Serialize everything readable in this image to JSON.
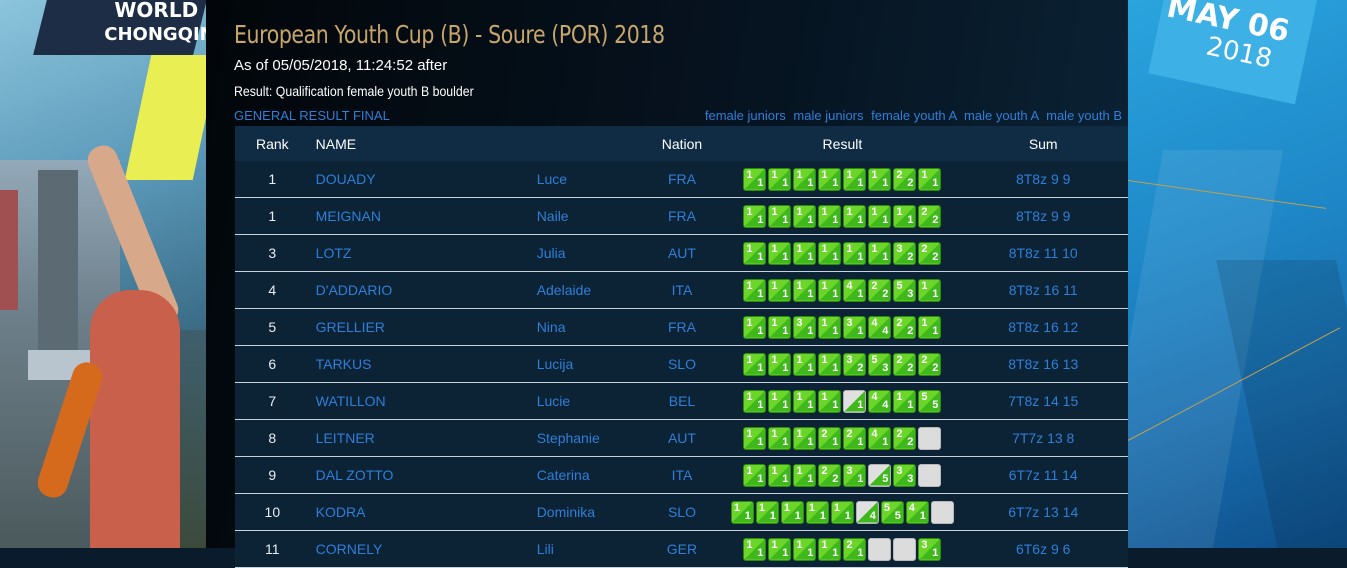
{
  "event_title": "European Youth Cup (B) - Soure (POR) 2018",
  "as_of": "As of 05/05/2018, 11:24:52 after",
  "result_label": "Result: Qualification female youth B boulder",
  "general_link": "GENERAL RESULT FINAL",
  "category_links": [
    "female juniors",
    "male juniors",
    "female youth A",
    "male youth A",
    "male youth B"
  ],
  "banner_left": {
    "line1": "WORLD",
    "line2": "CHONGQIN"
  },
  "banner_right": {
    "date": "MAY 06",
    "year": "2018"
  },
  "colors": {
    "link": "#2f7fd8",
    "title": "#c8a56a",
    "top_box": "#3fb81b",
    "empty_box": "#dcdcdc"
  },
  "table": {
    "headers": {
      "rank": "Rank",
      "name": "NAME",
      "nation": "Nation",
      "result": "Result",
      "sum": "Sum"
    },
    "rows": [
      {
        "rank": "1",
        "last": "DOUADY",
        "first": "Luce",
        "nation": "FRA",
        "sum": "8T8z  9   9",
        "boulders": [
          [
            "1",
            "1"
          ],
          [
            "1",
            "1"
          ],
          [
            "1",
            "1"
          ],
          [
            "1",
            "1"
          ],
          [
            "1",
            "1"
          ],
          [
            "1",
            "1"
          ],
          [
            "2",
            "2"
          ],
          [
            "1",
            "1"
          ]
        ]
      },
      {
        "rank": "1",
        "last": "MEIGNAN",
        "first": "Naile",
        "nation": "FRA",
        "sum": "8T8z  9   9",
        "boulders": [
          [
            "1",
            "1"
          ],
          [
            "1",
            "1"
          ],
          [
            "1",
            "1"
          ],
          [
            "1",
            "1"
          ],
          [
            "1",
            "1"
          ],
          [
            "1",
            "1"
          ],
          [
            "1",
            "1"
          ],
          [
            "2",
            "2"
          ]
        ]
      },
      {
        "rank": "3",
        "last": "LOTZ",
        "first": "Julia",
        "nation": "AUT",
        "sum": "8T8z  11 10",
        "boulders": [
          [
            "1",
            "1"
          ],
          [
            "1",
            "1"
          ],
          [
            "1",
            "1"
          ],
          [
            "1",
            "1"
          ],
          [
            "1",
            "1"
          ],
          [
            "1",
            "1"
          ],
          [
            "3",
            "2"
          ],
          [
            "2",
            "2"
          ]
        ]
      },
      {
        "rank": "4",
        "last": "D'ADDARIO",
        "first": "Adelaide",
        "nation": "ITA",
        "sum": "8T8z  16 11",
        "boulders": [
          [
            "1",
            "1"
          ],
          [
            "1",
            "1"
          ],
          [
            "1",
            "1"
          ],
          [
            "1",
            "1"
          ],
          [
            "4",
            "1"
          ],
          [
            "2",
            "2"
          ],
          [
            "5",
            "3"
          ],
          [
            "1",
            "1"
          ]
        ]
      },
      {
        "rank": "5",
        "last": "GRELLIER",
        "first": "Nina",
        "nation": "FRA",
        "sum": "8T8z  16 12",
        "boulders": [
          [
            "1",
            "1"
          ],
          [
            "1",
            "1"
          ],
          [
            "3",
            "1"
          ],
          [
            "1",
            "1"
          ],
          [
            "3",
            "1"
          ],
          [
            "4",
            "4"
          ],
          [
            "2",
            "2"
          ],
          [
            "1",
            "1"
          ]
        ]
      },
      {
        "rank": "6",
        "last": "TARKUS",
        "first": "Lucija",
        "nation": "SLO",
        "sum": "8T8z  16 13",
        "boulders": [
          [
            "1",
            "1"
          ],
          [
            "1",
            "1"
          ],
          [
            "1",
            "1"
          ],
          [
            "1",
            "1"
          ],
          [
            "3",
            "2"
          ],
          [
            "5",
            "3"
          ],
          [
            "2",
            "2"
          ],
          [
            "2",
            "2"
          ]
        ]
      },
      {
        "rank": "7",
        "last": "WATILLON",
        "first": "Lucie",
        "nation": "BEL",
        "sum": "7T8z  14 15",
        "boulders": [
          [
            "1",
            "1"
          ],
          [
            "1",
            "1"
          ],
          [
            "1",
            "1"
          ],
          [
            "1",
            "1"
          ],
          [
            "",
            "1"
          ],
          [
            "4",
            "4"
          ],
          [
            "1",
            "1"
          ],
          [
            "5",
            "5"
          ]
        ]
      },
      {
        "rank": "8",
        "last": "LEITNER",
        "first": "Stephanie",
        "nation": "AUT",
        "sum": "7T7z  13  8",
        "boulders": [
          [
            "1",
            "1"
          ],
          [
            "1",
            "1"
          ],
          [
            "1",
            "1"
          ],
          [
            "2",
            "1"
          ],
          [
            "2",
            "1"
          ],
          [
            "4",
            "1"
          ],
          [
            "2",
            "2"
          ],
          [
            "",
            ""
          ]
        ]
      },
      {
        "rank": "9",
        "last": "DAL ZOTTO",
        "first": "Caterina",
        "nation": "ITA",
        "sum": "6T7z  11 14",
        "boulders": [
          [
            "1",
            "1"
          ],
          [
            "1",
            "1"
          ],
          [
            "1",
            "1"
          ],
          [
            "2",
            "2"
          ],
          [
            "3",
            "1"
          ],
          [
            "",
            "5"
          ],
          [
            "3",
            "3"
          ],
          [
            "",
            ""
          ]
        ]
      },
      {
        "rank": "10",
        "last": "KODRA",
        "first": "Dominika",
        "nation": "SLO",
        "sum": "6T7z  13 14",
        "boulders": [
          [
            "1",
            "1"
          ],
          [
            "1",
            "1"
          ],
          [
            "1",
            "1"
          ],
          [
            "1",
            "1"
          ],
          [
            "1",
            "1"
          ],
          [
            "",
            "4"
          ],
          [
            "5",
            "5"
          ],
          [
            "4",
            "1"
          ],
          [
            "",
            ""
          ]
        ]
      },
      {
        "rank": "11",
        "last": "CORNELY",
        "first": "Lili",
        "nation": "GER",
        "sum": "6T6z  9   6",
        "boulders": [
          [
            "1",
            "1"
          ],
          [
            "1",
            "1"
          ],
          [
            "1",
            "1"
          ],
          [
            "1",
            "1"
          ],
          [
            "2",
            "1"
          ],
          [
            "",
            ""
          ],
          [
            "",
            ""
          ],
          [
            "3",
            "1"
          ]
        ]
      }
    ]
  }
}
